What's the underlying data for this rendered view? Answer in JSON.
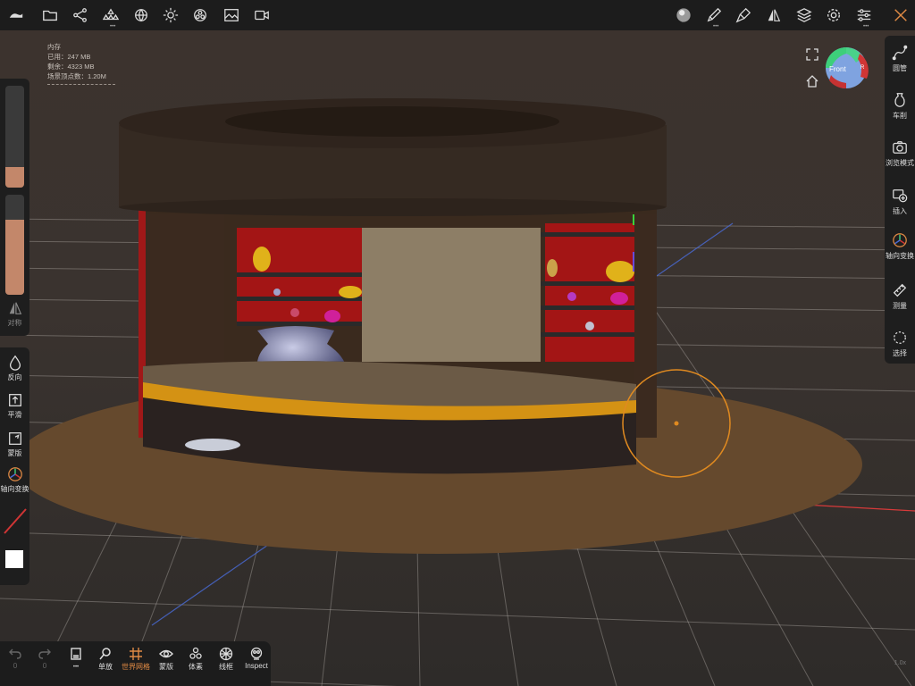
{
  "memory": {
    "title": "内存",
    "used": "已用：247 MB",
    "free": "剩余：4323 MB",
    "vertices": "场景顶点数：1.20M"
  },
  "view_cube": {
    "label": "Front",
    "side_label": "R"
  },
  "left_panel": {
    "size_slider_level": 0.2,
    "opacity_slider_level": 0.75,
    "symmetry_label": "对称",
    "tools": [
      {
        "name": "invert",
        "label": "反向"
      },
      {
        "name": "smooth",
        "label": "平滑"
      },
      {
        "name": "mask",
        "label": "蒙版"
      },
      {
        "name": "gizmo",
        "label": "轴向变换"
      }
    ]
  },
  "right_panel": {
    "tools": [
      {
        "label": "圆管"
      },
      {
        "label": "车削"
      },
      {
        "label": "浏览模式"
      },
      {
        "label": "插入"
      },
      {
        "label": "轴向变换"
      },
      {
        "label": "测量"
      },
      {
        "label": "选择"
      }
    ]
  },
  "bottom_bar": {
    "undo_count": "0",
    "redo_count": "0",
    "items": [
      {
        "label": "单放"
      },
      {
        "label": "世界网格"
      },
      {
        "label": "蒙版"
      },
      {
        "label": "体素"
      },
      {
        "label": "线框"
      },
      {
        "label": "Inspect"
      }
    ]
  },
  "zoom_value": "1.0x",
  "colors": {
    "accent": "#e08a44",
    "brush_color": "#c3876a",
    "panel_bg": "#1e1e1e"
  }
}
